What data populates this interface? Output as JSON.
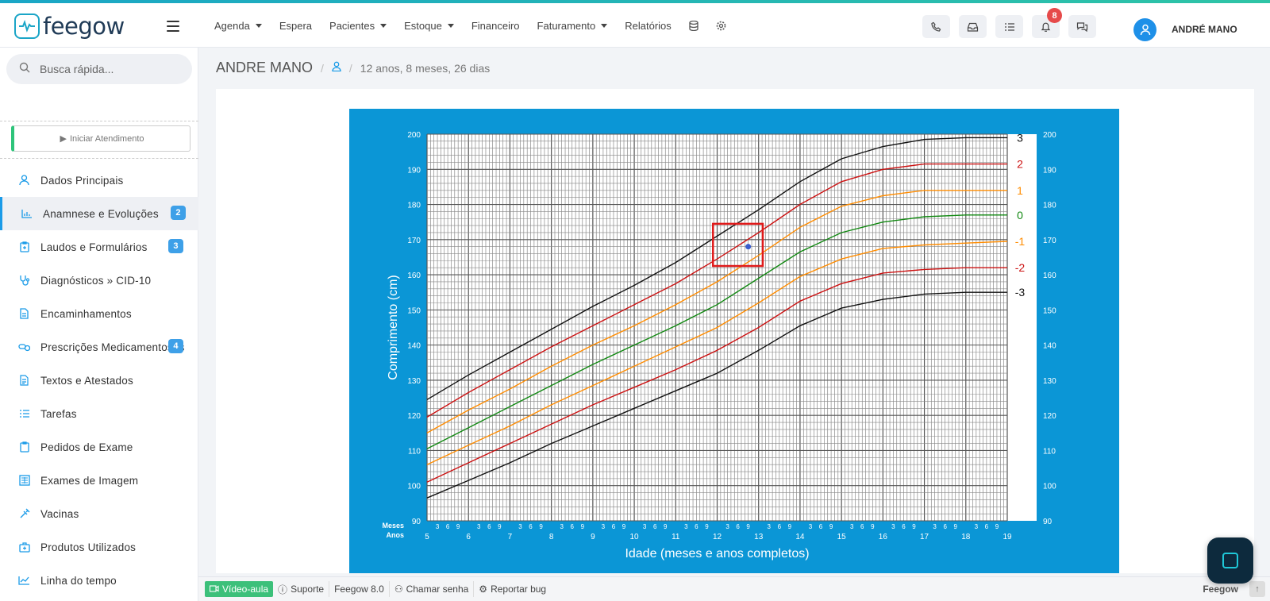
{
  "app": {
    "logo_text": "feegow",
    "brand_color": "#1ba5c7",
    "accent_blue": "#1a9be8"
  },
  "nav": {
    "items": [
      {
        "label": "Agenda",
        "dropdown": true
      },
      {
        "label": "Espera",
        "dropdown": false
      },
      {
        "label": "Pacientes",
        "dropdown": true
      },
      {
        "label": "Estoque",
        "dropdown": true
      },
      {
        "label": "Financeiro",
        "dropdown": false
      },
      {
        "label": "Faturamento",
        "dropdown": true
      },
      {
        "label": "Relatórios",
        "dropdown": false
      }
    ],
    "icons": [
      "database-icon",
      "gear-icon"
    ]
  },
  "toolbar": {
    "buttons": [
      "phone-icon",
      "inbox-icon",
      "checklist-icon",
      "bell-icon",
      "chat-icon"
    ],
    "notification_count": "8",
    "user_name": "ANDRÉ MANO"
  },
  "sidebar": {
    "search_placeholder": "Busca rápida...",
    "start_button": "Iniciar Atendimento",
    "items": [
      {
        "label": "Dados Principais",
        "icon": "user-icon",
        "badge": ""
      },
      {
        "label": "Anamnese e Evoluções",
        "icon": "chart-icon",
        "badge": "2",
        "active": true
      },
      {
        "label": "Laudos e Formulários",
        "icon": "clipboard-icon",
        "badge": "3"
      },
      {
        "label": "Diagnósticos » CID-10",
        "icon": "stethoscope-icon",
        "badge": ""
      },
      {
        "label": "Encaminhamentos",
        "icon": "file-icon",
        "badge": ""
      },
      {
        "label": "Prescrições Medicamentosas",
        "icon": "pills-icon",
        "badge": "4"
      },
      {
        "label": "Textos e Atestados",
        "icon": "document-icon",
        "badge": ""
      },
      {
        "label": "Tarefas",
        "icon": "tasks-icon",
        "badge": ""
      },
      {
        "label": "Pedidos de Exame",
        "icon": "exam-icon",
        "badge": ""
      },
      {
        "label": "Exames de Imagem",
        "icon": "image-exam-icon",
        "badge": ""
      },
      {
        "label": "Vacinas",
        "icon": "syringe-icon",
        "badge": ""
      },
      {
        "label": "Produtos Utilizados",
        "icon": "medkit-icon",
        "badge": ""
      },
      {
        "label": "Linha do tempo",
        "icon": "timeline-icon",
        "badge": ""
      }
    ]
  },
  "breadcrumb": {
    "patient": "ANDRE MANO",
    "age": "12 anos, 8 meses, 26 dias"
  },
  "chart_data": {
    "type": "line",
    "ylabel": "Comprimento (cm)",
    "xlabel": "Idade (meses e anos completos)",
    "xlim": [
      5,
      19
    ],
    "ylim": [
      90,
      200
    ],
    "x_ticks": [
      "5",
      "6",
      "7",
      "8",
      "9",
      "10",
      "11",
      "12",
      "13",
      "14",
      "15",
      "16",
      "17",
      "18",
      "19"
    ],
    "y_ticks": [
      "90",
      "100",
      "110",
      "120",
      "130",
      "140",
      "150",
      "160",
      "170",
      "180",
      "190",
      "200"
    ],
    "x_minor_ticks": [
      "3",
      "6",
      "9"
    ],
    "x_axis_labels": [
      "Meses",
      "Anos"
    ],
    "background": "#0b96d6",
    "x": [
      5,
      6,
      7,
      8,
      9,
      10,
      11,
      12,
      13,
      14,
      15,
      16,
      17,
      18,
      19
    ],
    "series": [
      {
        "name": "3",
        "color": "#111111",
        "values": [
          124.5,
          131.5,
          138,
          144.5,
          151,
          157,
          163.5,
          171,
          178.5,
          186.5,
          193,
          196.5,
          198.5,
          199,
          199
        ]
      },
      {
        "name": "2",
        "color": "#cc1111",
        "values": [
          119.5,
          126.5,
          133,
          139.5,
          145.5,
          151.5,
          157.5,
          164.5,
          172,
          180,
          186.5,
          190,
          191.5,
          191.5,
          191.5
        ]
      },
      {
        "name": "1",
        "color": "#ff8c00",
        "values": [
          115,
          121.5,
          127.5,
          134,
          140,
          145.5,
          151.5,
          158,
          165.5,
          173.5,
          179.5,
          182.5,
          184,
          184,
          184
        ]
      },
      {
        "name": "0",
        "color": "#118811",
        "values": [
          110.5,
          116.5,
          122.5,
          128.5,
          134.5,
          140,
          145.5,
          151.5,
          159,
          166.5,
          172,
          175,
          176.5,
          177,
          177
        ]
      },
      {
        "name": "-1",
        "color": "#ff8c00",
        "values": [
          106,
          111.5,
          117,
          123,
          128.5,
          134,
          139.5,
          145,
          152,
          159.5,
          164.5,
          167.5,
          168.5,
          169,
          169.5
        ]
      },
      {
        "name": "-2",
        "color": "#cc1111",
        "values": [
          101,
          106.5,
          112,
          117.5,
          123,
          128,
          133,
          138.5,
          145,
          152.5,
          157.5,
          160.5,
          161.5,
          162,
          162
        ]
      },
      {
        "name": "-3",
        "color": "#111111",
        "values": [
          96.5,
          101.5,
          106.5,
          112,
          117,
          122,
          127,
          132,
          138.5,
          145.5,
          150.5,
          153,
          154.5,
          155,
          155
        ]
      }
    ],
    "point": {
      "x": 12.75,
      "y": 168
    },
    "highlight_box": {
      "x0": 11.9,
      "x1": 13.1,
      "y0": 162.5,
      "y1": 174.5
    }
  },
  "footer": {
    "video": "Vídeo-aula",
    "support": "Suporte",
    "version": "Feegow 8.0",
    "call": "Chamar senha",
    "bug": "Reportar bug",
    "brand": "Feegow"
  }
}
